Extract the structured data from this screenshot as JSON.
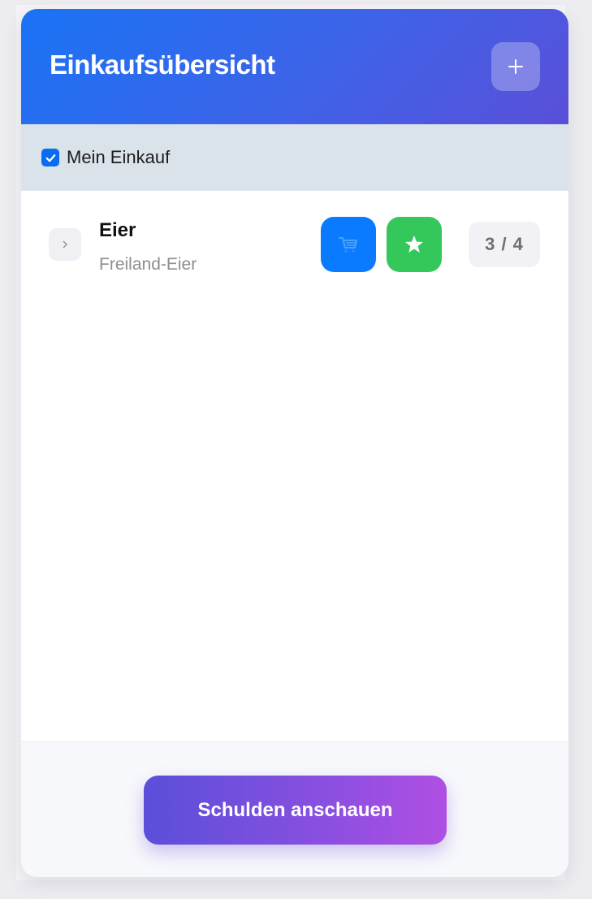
{
  "header": {
    "title": "Einkaufsübersicht",
    "add_icon": "plus-icon"
  },
  "list": {
    "checked": true,
    "label": "Mein Einkauf"
  },
  "items": [
    {
      "name": "Eier",
      "subtitle": "Freiland-Eier",
      "quantity": "3 / 4",
      "actions": [
        "cart-icon",
        "star-icon"
      ]
    }
  ],
  "footer": {
    "button_label": "Schulden anschauen"
  },
  "colors": {
    "header_gradient_start": "#1a73f5",
    "header_gradient_end": "#5a4fd9",
    "checkbox": "#0a6cf1",
    "cart_button": "#0a7bff",
    "star_button": "#34c759",
    "cta_gradient_start": "#5a4fd9",
    "cta_gradient_end": "#b04fe3"
  }
}
